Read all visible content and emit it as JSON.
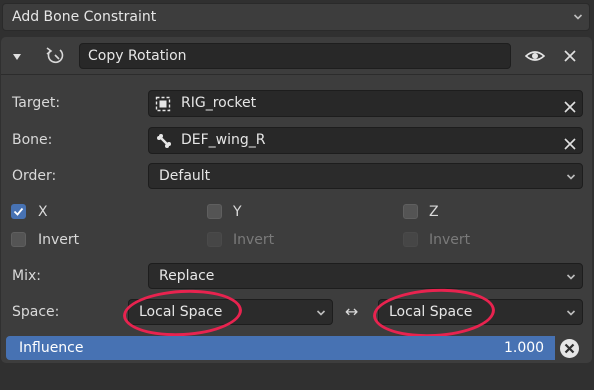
{
  "header_dropdown": {
    "label": "Add Bone Constraint"
  },
  "constraint": {
    "name": "Copy Rotation"
  },
  "target": {
    "label": "Target:",
    "value": "RIG_rocket"
  },
  "bone": {
    "label": "Bone:",
    "value": "DEF_wing_R"
  },
  "order": {
    "label": "Order:",
    "value": "Default"
  },
  "axes": {
    "x": {
      "label": "X",
      "checked": true
    },
    "y": {
      "label": "Y",
      "checked": false
    },
    "z": {
      "label": "Z",
      "checked": false
    }
  },
  "invert": {
    "x": {
      "label": "Invert",
      "checked": false,
      "enabled": true
    },
    "y": {
      "label": "Invert",
      "checked": false,
      "enabled": false
    },
    "z": {
      "label": "Invert",
      "checked": false,
      "enabled": false
    }
  },
  "mix": {
    "label": "Mix:",
    "value": "Replace"
  },
  "space": {
    "label": "Space:",
    "owner": "Local Space",
    "target": "Local Space",
    "arrow": "↔"
  },
  "influence": {
    "label": "Influence",
    "value": "1.000",
    "fraction": 1.0
  },
  "colors": {
    "accent": "#4772b3",
    "annotation": "#e8234f",
    "panel": "#3d3d3d",
    "field": "#282828"
  },
  "icons": [
    "chevron-down-icon",
    "collapse-triangle-icon",
    "copy-rotation-icon",
    "eye-icon",
    "close-icon",
    "object-icon",
    "bone-icon",
    "clear-icon",
    "double-arrow-icon"
  ]
}
